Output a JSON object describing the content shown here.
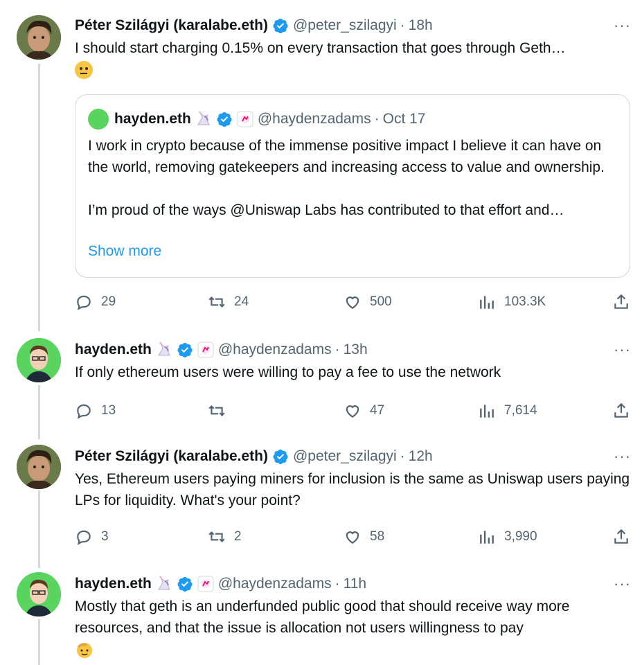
{
  "tweets": [
    {
      "name": "Péter Szilágyi (karalabe.eth)",
      "handle": "@peter_szilagyi",
      "sep": "·",
      "time": "18h",
      "text": "I should start charging 0.15% on every transaction that goes through Geth…",
      "emoji": "thinking-face",
      "quote": {
        "name": "hayden.eth",
        "handle": "@haydenzadams",
        "sep": "·",
        "time": "Oct 17",
        "text_p1": "I work in crypto because of the immense positive impact I believe it can have on the world, removing gatekeepers and increasing access to value and ownership.",
        "text_p2": "I’m proud of the ways @Uniswap Labs has contributed to that effort and…",
        "show_more": "Show more"
      },
      "stats": {
        "replies": "29",
        "retweets": "24",
        "likes": "500",
        "views": "103.3K"
      }
    },
    {
      "name": "hayden.eth",
      "handle": "@haydenzadams",
      "sep": "·",
      "time": "13h",
      "text": "If only ethereum users were willing to pay a fee to use the network",
      "stats": {
        "replies": "13",
        "retweets": "",
        "likes": "47",
        "views": "7,614"
      }
    },
    {
      "name": "Péter Szilágyi (karalabe.eth)",
      "handle": "@peter_szilagyi",
      "sep": "·",
      "time": "12h",
      "text": "Yes, Ethereum users paying miners for inclusion is the same as Uniswap users paying LPs for liquidity. What's your point?",
      "stats": {
        "replies": "3",
        "retweets": "2",
        "likes": "58",
        "views": "3,990"
      }
    },
    {
      "name": "hayden.eth",
      "handle": "@haydenzadams",
      "sep": "·",
      "time": "11h",
      "text": "Mostly that geth is an underfunded public good that should receive way more resources, and that the issue is allocation not users willingness to pay",
      "emoji": "saluting-face"
    }
  ],
  "more_label": "···",
  "colors": {
    "accent": "#1d9bf0",
    "secondary": "#536471",
    "border": "#cfd9de",
    "verified": "#1d9bf0"
  }
}
